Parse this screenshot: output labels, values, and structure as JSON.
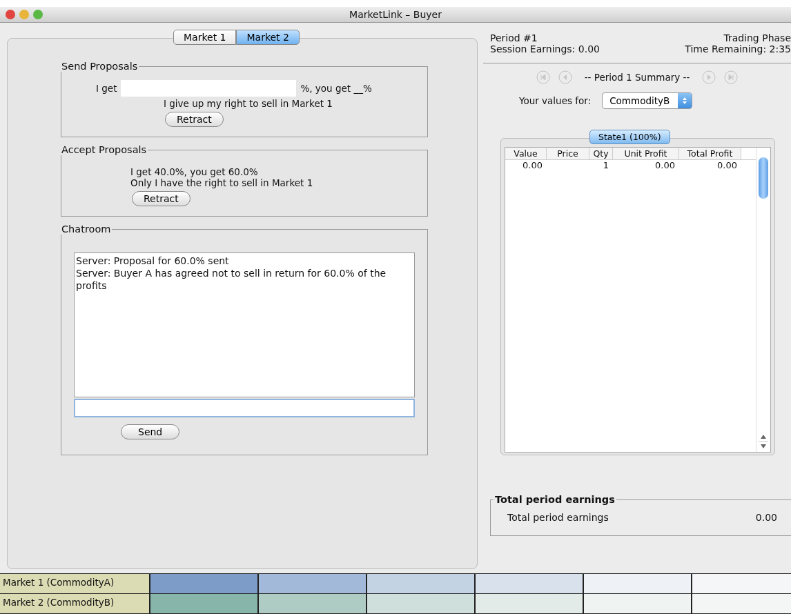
{
  "window": {
    "title": "MarketLink – Buyer"
  },
  "market_tabs": [
    {
      "label": "Market 1",
      "selected": false
    },
    {
      "label": "Market 2",
      "selected": true
    }
  ],
  "send_proposals": {
    "title": "Send Proposals",
    "prefix": "I get",
    "suffix": "%, you get __%",
    "note": "I give up my right to sell in Market 1",
    "button": "Retract"
  },
  "accept_proposals": {
    "title": "Accept Proposals",
    "lines": [
      "I get 40.0%, you get 60.0%",
      "Only I have the right to sell in Market 1"
    ],
    "button": "Retract"
  },
  "chatroom": {
    "title": "Chatroom",
    "messages": [
      "Server: Proposal for 60.0% sent",
      "Server: Buyer A has agreed not to sell in return for 60.0% of the profits"
    ],
    "button": "Send"
  },
  "status": {
    "period": "Period #1",
    "phase": "Trading Phase",
    "earnings": "Session Earnings: 0.00",
    "time": "Time Remaining: 2:35"
  },
  "nav_buttons": [
    {
      "kind": "first",
      "disabled": true
    },
    {
      "kind": "prev",
      "disabled": true
    },
    {
      "kind": "next",
      "disabled": true
    },
    {
      "kind": "last",
      "disabled": true
    }
  ],
  "summary": {
    "title": "-- Period 1 Summary --",
    "values_label": "Your values for:",
    "commodity": "CommodityB"
  },
  "state_tabs": [
    {
      "label": "State1 (100%)",
      "selected": true
    }
  ],
  "table": {
    "columns": [
      "Value",
      "Price",
      "Qty",
      "Unit Profit",
      "Total Profit"
    ],
    "rows": [
      {
        "value": "0.00",
        "qty": "1",
        "unit_profit": "0.00",
        "total_profit": "0.00"
      }
    ]
  },
  "total_earnings": {
    "title": "Total period earnings",
    "label": "Total period earnings",
    "value": "0.00"
  },
  "markets_grid": [
    {
      "label": "Market 1 (CommodityA)",
      "cells": [
        {
          "color": "#7d9dc8"
        },
        {
          "color": "#a3b9d9"
        },
        {
          "color": "#c4d3e4"
        },
        {
          "color": "#d8e1ec"
        },
        {
          "color": "#eef1f5"
        },
        {
          "color": "#f4f6f8"
        }
      ]
    },
    {
      "label": "Market 2 (CommodityB)",
      "cells": [
        {
          "color": "#88b5aa"
        },
        {
          "color": "#aecbc4"
        },
        {
          "color": "#cfdfdb"
        },
        {
          "color": "#e2ebe8"
        },
        {
          "color": "#eff3f2"
        },
        {
          "color": "#f4f6f6"
        }
      ]
    }
  ]
}
